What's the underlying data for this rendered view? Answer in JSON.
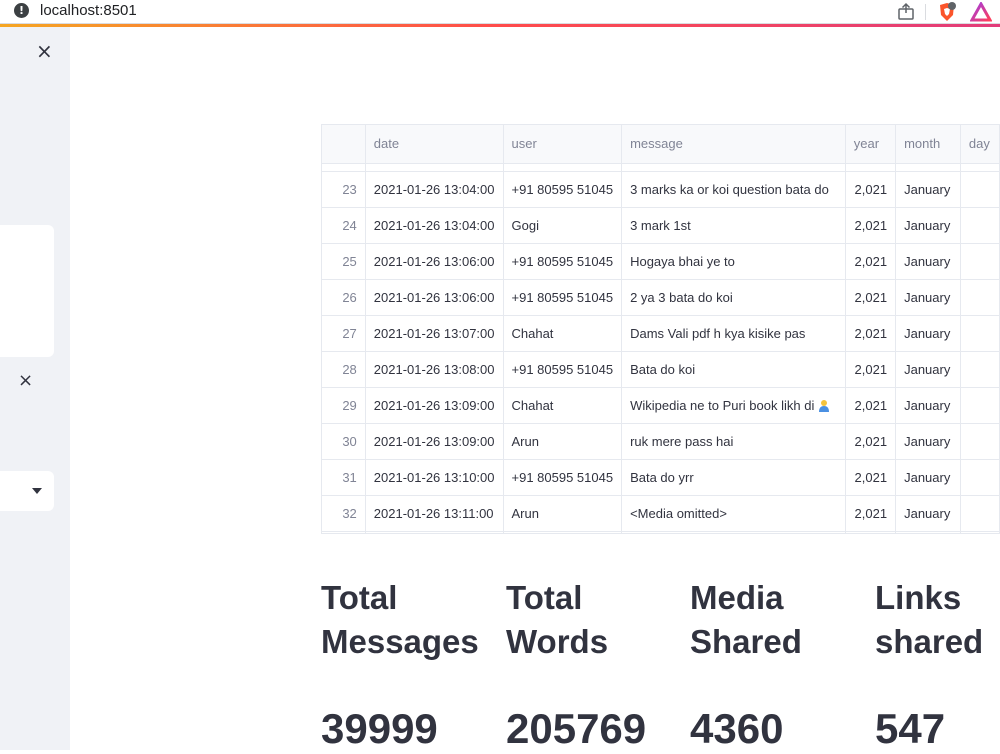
{
  "browser": {
    "url": "localhost:8501"
  },
  "sidebar": {
    "close_glyph": "×"
  },
  "table": {
    "columns": [
      "",
      "date",
      "user",
      "message",
      "year",
      "month",
      "day"
    ],
    "rows": [
      {
        "idx": "23",
        "date": "2021-01-26 13:04:00",
        "user": "+91 80595 51045",
        "message": "3 marks ka or koi question bata do",
        "year": "2,021",
        "month": "January"
      },
      {
        "idx": "24",
        "date": "2021-01-26 13:04:00",
        "user": "Gogi",
        "message": "3 mark 1st",
        "year": "2,021",
        "month": "January"
      },
      {
        "idx": "25",
        "date": "2021-01-26 13:06:00",
        "user": "+91 80595 51045",
        "message": "Hogaya bhai ye to",
        "year": "2,021",
        "month": "January"
      },
      {
        "idx": "26",
        "date": "2021-01-26 13:06:00",
        "user": "+91 80595 51045",
        "message": "2 ya 3 bata do koi",
        "year": "2,021",
        "month": "January"
      },
      {
        "idx": "27",
        "date": "2021-01-26 13:07:00",
        "user": "Chahat",
        "message": "Dams Vali pdf h kya kisike pas",
        "year": "2,021",
        "month": "January"
      },
      {
        "idx": "28",
        "date": "2021-01-26 13:08:00",
        "user": "+91 80595 51045",
        "message": "Bata do koi",
        "year": "2,021",
        "month": "January"
      },
      {
        "idx": "29",
        "date": "2021-01-26 13:09:00",
        "user": "Chahat",
        "message": "Wikipedia ne to Puri book likh di",
        "year": "2,021",
        "month": "January",
        "emoji": "person-emoji"
      },
      {
        "idx": "30",
        "date": "2021-01-26 13:09:00",
        "user": "Arun",
        "message": "ruk mere pass hai",
        "year": "2,021",
        "month": "January"
      },
      {
        "idx": "31",
        "date": "2021-01-26 13:10:00",
        "user": "+91 80595 51045",
        "message": "Bata do yrr",
        "year": "2,021",
        "month": "January"
      },
      {
        "idx": "32",
        "date": "2021-01-26 13:11:00",
        "user": "Arun",
        "message": "<Media omitted>",
        "year": "2,021",
        "month": "January"
      }
    ]
  },
  "metrics": [
    {
      "label_line1": "Total",
      "label_line2": "Messages",
      "value": "39999"
    },
    {
      "label_line1": "Total",
      "label_line2": "Words",
      "value": "205769"
    },
    {
      "label_line1": "Media",
      "label_line2": "Shared",
      "value": "4360"
    },
    {
      "label_line1": "Links",
      "label_line2": "shared",
      "value": "547"
    }
  ],
  "colors": {
    "sidebar_bg": "#f0f2f6",
    "text": "#31333f",
    "header_text": "#808495",
    "grid": "#e6e9ef"
  }
}
